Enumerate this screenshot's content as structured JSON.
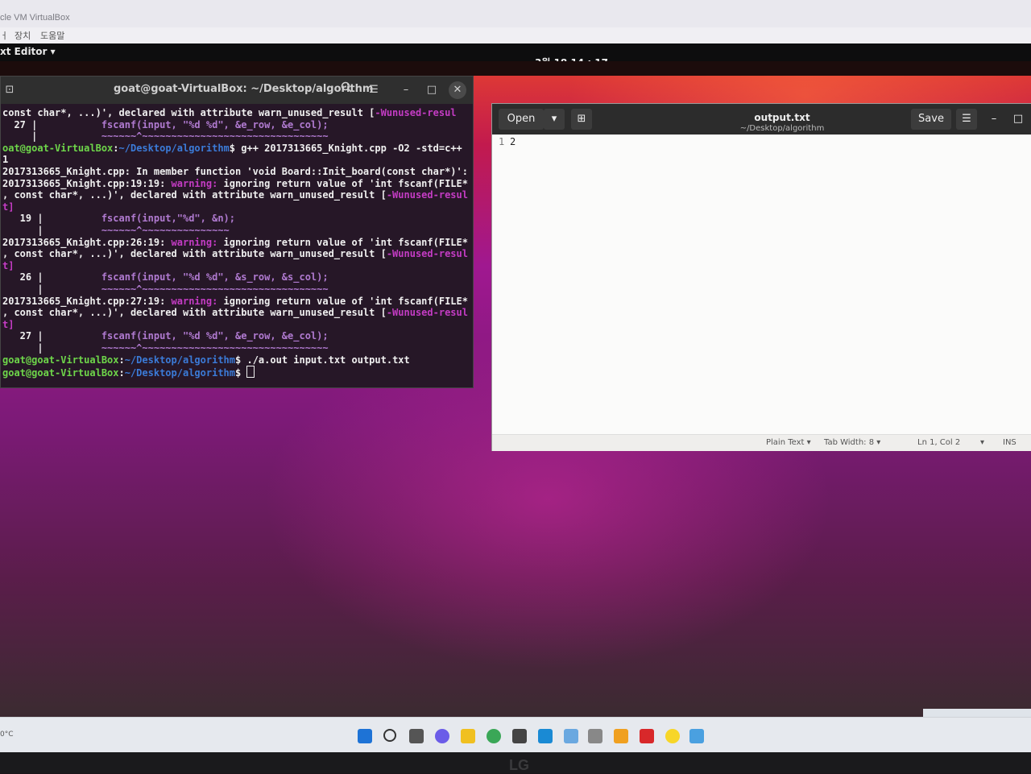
{
  "host": {
    "window_title": "cle VM VirtualBox",
    "menu": [
      "ㅓ",
      "장치",
      "도움말"
    ]
  },
  "gnome_topbar": {
    "app_menu": "xt Editor ▾",
    "clock": "3월 18  14 : 17"
  },
  "terminal": {
    "title": "goat@goat-VirtualBox: ~/Desktop/algorithm",
    "lines": [
      {
        "segments": [
          {
            "t": "const char*, ...)', declared with attribute warn_unused_result [",
            "c": "n"
          },
          {
            "t": "-Wunused-resul",
            "c": "warn"
          }
        ]
      },
      {
        "segments": [
          {
            "t": "  27 |           ",
            "c": "n"
          },
          {
            "t": "fscanf(input, \"%d %d\", &e_row, &e_col);",
            "c": "dim"
          }
        ]
      },
      {
        "segments": [
          {
            "t": "     |           ",
            "c": "n"
          },
          {
            "t": "~~~~~~^~~~~~~~~~~~~~~~~~~~~~~~~~~~~~~~~",
            "c": "dim"
          }
        ]
      },
      {
        "segments": [
          {
            "t": "oat@goat-VirtualBox",
            "c": "ok"
          },
          {
            "t": ":",
            "c": "n"
          },
          {
            "t": "~/Desktop/algorithm",
            "c": "path"
          },
          {
            "t": "$ g++ 2017313665_Knight.cpp -O2 -std=c++",
            "c": "n"
          }
        ]
      },
      {
        "segments": [
          {
            "t": "1",
            "c": "n"
          }
        ]
      },
      {
        "segments": [
          {
            "t": "2017313665_Knight.cpp: In member function 'void Board::Init_board(const char*)':",
            "c": "n"
          }
        ]
      },
      {
        "segments": [
          {
            "t": "2017313665_Knight.cpp:19:19: ",
            "c": "n"
          },
          {
            "t": "warning:",
            "c": "warn"
          },
          {
            "t": " ignoring return value of 'int fscanf(FILE*",
            "c": "n"
          }
        ]
      },
      {
        "segments": [
          {
            "t": ", const char*, ...)', declared with attribute warn_unused_result [",
            "c": "n"
          },
          {
            "t": "-Wunused-resul",
            "c": "warn"
          }
        ]
      },
      {
        "segments": [
          {
            "t": "t]",
            "c": "warn"
          }
        ]
      },
      {
        "segments": [
          {
            "t": "   19 |          ",
            "c": "n"
          },
          {
            "t": "fscanf(input,\"%d\", &n);",
            "c": "dim"
          }
        ]
      },
      {
        "segments": [
          {
            "t": "      |          ",
            "c": "n"
          },
          {
            "t": "~~~~~~^~~~~~~~~~~~~~~~",
            "c": "dim"
          }
        ]
      },
      {
        "segments": [
          {
            "t": "2017313665_Knight.cpp:26:19: ",
            "c": "n"
          },
          {
            "t": "warning:",
            "c": "warn"
          },
          {
            "t": " ignoring return value of 'int fscanf(FILE*",
            "c": "n"
          }
        ]
      },
      {
        "segments": [
          {
            "t": ", const char*, ...)', declared with attribute warn_unused_result [",
            "c": "n"
          },
          {
            "t": "-Wunused-resul",
            "c": "warn"
          }
        ]
      },
      {
        "segments": [
          {
            "t": "t]",
            "c": "warn"
          }
        ]
      },
      {
        "segments": [
          {
            "t": "   26 |          ",
            "c": "n"
          },
          {
            "t": "fscanf(input, \"%d %d\", &s_row, &s_col);",
            "c": "dim"
          }
        ]
      },
      {
        "segments": [
          {
            "t": "      |          ",
            "c": "n"
          },
          {
            "t": "~~~~~~^~~~~~~~~~~~~~~~~~~~~~~~~~~~~~~~~",
            "c": "dim"
          }
        ]
      },
      {
        "segments": [
          {
            "t": "2017313665_Knight.cpp:27:19: ",
            "c": "n"
          },
          {
            "t": "warning:",
            "c": "warn"
          },
          {
            "t": " ignoring return value of 'int fscanf(FILE*",
            "c": "n"
          }
        ]
      },
      {
        "segments": [
          {
            "t": ", const char*, ...)', declared with attribute warn_unused_result [",
            "c": "n"
          },
          {
            "t": "-Wunused-resul",
            "c": "warn"
          }
        ]
      },
      {
        "segments": [
          {
            "t": "t]",
            "c": "warn"
          }
        ]
      },
      {
        "segments": [
          {
            "t": "   27 |          ",
            "c": "n"
          },
          {
            "t": "fscanf(input, \"%d %d\", &e_row, &e_col);",
            "c": "dim"
          }
        ]
      },
      {
        "segments": [
          {
            "t": "      |          ",
            "c": "n"
          },
          {
            "t": "~~~~~~^~~~~~~~~~~~~~~~~~~~~~~~~~~~~~~~~",
            "c": "dim"
          }
        ]
      },
      {
        "segments": [
          {
            "t": "goat@goat-VirtualBox",
            "c": "ok"
          },
          {
            "t": ":",
            "c": "n"
          },
          {
            "t": "~/Desktop/algorithm",
            "c": "path"
          },
          {
            "t": "$ ./a.out input.txt output.txt",
            "c": "n"
          }
        ]
      },
      {
        "segments": [
          {
            "t": "goat@goat-VirtualBox",
            "c": "ok"
          },
          {
            "t": ":",
            "c": "n"
          },
          {
            "t": "~/Desktop/algorithm",
            "c": "path"
          },
          {
            "t": "$ ",
            "c": "n"
          },
          {
            "t": "",
            "c": "cursor"
          }
        ]
      }
    ]
  },
  "editor": {
    "open_label": "Open",
    "save_label": "Save",
    "file_name": "output.txt",
    "file_path": "~/Desktop/algorithm",
    "line_number": "1",
    "content": "2",
    "status": {
      "syntax": "Plain Text ▾",
      "tab_width": "Tab Width: 8 ▾",
      "position": "Ln 1, Col 2",
      "mode": "INS"
    }
  },
  "taskbar": {
    "weather": "0°C",
    "icons": [
      "windows-start-icon",
      "search-icon",
      "task-view-icon",
      "chat-icon",
      "file-explorer-icon",
      "chrome-icon",
      "folder-icon",
      "vscode-icon",
      "mail-icon",
      "virtualbox-icon",
      "paint-icon",
      "acrobat-icon",
      "kakaotalk-icon",
      "network-icon"
    ]
  },
  "bezel": {
    "brand": "LG"
  }
}
